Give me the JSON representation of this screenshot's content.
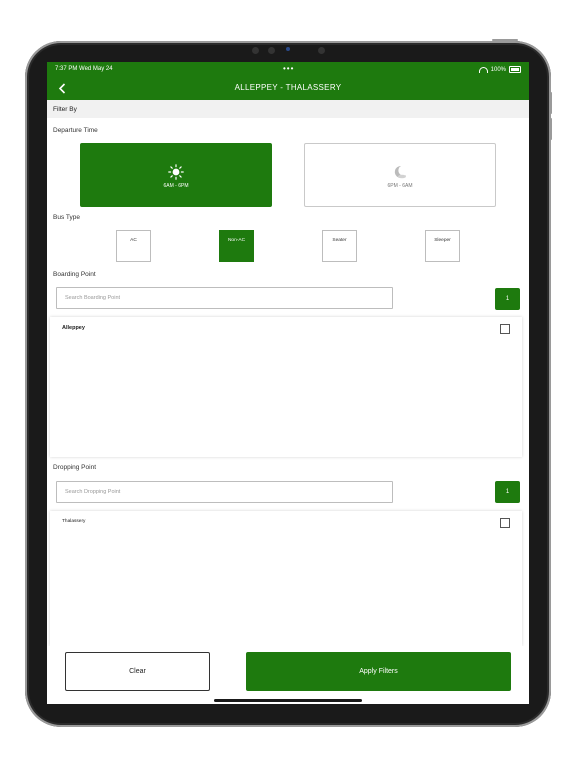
{
  "status_bar": {
    "time": "7:37 PM  Wed May 24",
    "dots": "•••",
    "battery": "100%"
  },
  "header": {
    "title": "ALLEPPEY - THALASSERY"
  },
  "filter_by": "Filter By",
  "departure": {
    "label": "Departure Time",
    "options": [
      {
        "label": "6AM - 6PM",
        "icon": "sun-icon",
        "selected": true
      },
      {
        "label": "6PM - 6AM",
        "icon": "moon-icon",
        "selected": false
      }
    ]
  },
  "bus_type": {
    "label": "Bus Type",
    "options": [
      {
        "label": "AC",
        "selected": false
      },
      {
        "label": "Non-AC",
        "selected": true
      },
      {
        "label": "Seater",
        "selected": false
      },
      {
        "label": "Sleeper",
        "selected": false
      }
    ]
  },
  "boarding": {
    "label": "Boarding Point",
    "search_placeholder": "Search Boarding Point",
    "count": "1",
    "items": [
      {
        "name": "Alleppey",
        "checked": false
      }
    ]
  },
  "dropping": {
    "label": "Dropping Point",
    "search_placeholder": "Search Dropping Point",
    "count": "1",
    "items": [
      {
        "name": "Thalassery",
        "checked": false
      }
    ]
  },
  "actions": {
    "clear": "Clear",
    "apply": "Apply Filters"
  },
  "colors": {
    "accent": "#1e7a0e"
  }
}
